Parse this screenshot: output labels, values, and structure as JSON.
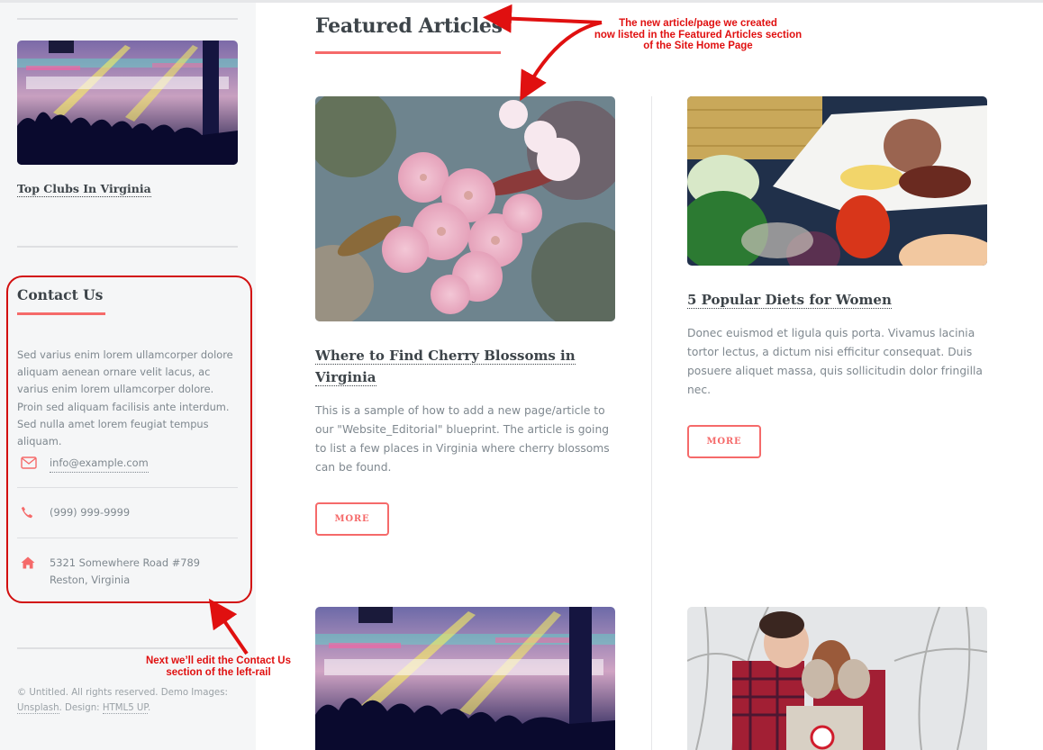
{
  "sidebar": {
    "mini_post": {
      "image_alt": "nightclub crowd with stage lights",
      "title": "Top Clubs In Virginia"
    },
    "contact": {
      "heading": "Contact Us",
      "description": "Sed varius enim lorem ullamcorper dolore aliquam aenean ornare velit lacus, ac varius enim lorem ullamcorper dolore. Proin sed aliquam facilisis ante interdum. Sed nulla amet lorem feugiat tempus aliquam.",
      "items": [
        {
          "icon": "envelope-icon",
          "text": "info@example.com"
        },
        {
          "icon": "phone-icon",
          "text": "(999) 999-9999"
        },
        {
          "icon": "home-icon",
          "line1": "5321 Somewhere Road #789",
          "line2": "Reston, Virginia"
        }
      ]
    },
    "footer": {
      "prefix": "© Untitled. All rights reserved. Demo Images: ",
      "link1": "Unsplash",
      "middle": ". Design: ",
      "link2": "HTML5 UP",
      "suffix": "."
    }
  },
  "main": {
    "title": "Featured Articles",
    "articles": [
      {
        "image_alt": "pink cherry blossoms",
        "title": "Where to Find Cherry Blossoms in Virginia",
        "body": "This is a sample of how to add a new page/article to our \"Website_Editorial\" blueprint. The article is going to list a few places in Virginia where cherry blossoms can be found.",
        "button": "MORE"
      },
      {
        "image_alt": "plate of food with vegetables",
        "title": "5 Popular Diets for Women",
        "body": "Donec euismod et ligula quis porta. Vivamus lacinia tortor lectus, a dictum nisi efficitur consequat. Duis posuere aliquet massa, quis sollicitudin dolor fringilla nec.",
        "button": "MORE"
      },
      {
        "image_alt": "nightclub crowd with stage lights"
      },
      {
        "image_alt": "couple in snowy forest"
      }
    ]
  },
  "annotations": {
    "top": [
      "The new article/page we created",
      "now listed in the Featured Articles section",
      "of the Site Home Page"
    ],
    "bottom": [
      "Next we’ll edit the Contact Us",
      "section of the left-rail"
    ]
  },
  "colors": {
    "accent": "#f56a6a",
    "heading": "#3d4449",
    "text": "#7f888f",
    "sidebar_bg": "#f5f6f7",
    "annotation": "#e01010"
  }
}
